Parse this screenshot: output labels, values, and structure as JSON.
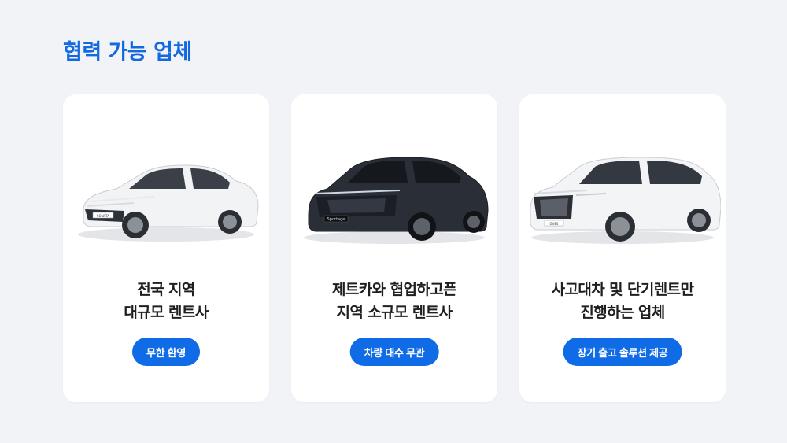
{
  "section": {
    "title": "협력 가능 업체"
  },
  "cards": [
    {
      "title_line1": "전국 지역",
      "title_line2": "대규모 렌트사",
      "badge": "무한 환영",
      "car": {
        "icon": "white-sedan-image",
        "plate_text": "SONATA",
        "body_color": "#f2f3f5"
      }
    },
    {
      "title_line1": "제트카와 협업하고픈",
      "title_line2": "지역 소규모 렌트사",
      "badge": "차량 대수 무관",
      "car": {
        "icon": "dark-suv-image",
        "plate_text": "Sportage",
        "body_color": "#2a2e37"
      }
    },
    {
      "title_line1": "사고대차 및 단기렌트만",
      "title_line2": "진행하는 업체",
      "badge": "장기 출고 솔루션 제공",
      "car": {
        "icon": "white-large-suv-image",
        "plate_text": "GV80",
        "body_color": "#f3f4f6"
      }
    }
  ],
  "colors": {
    "accent": "#1269e0",
    "badge": "#0f6be6",
    "background": "#f1f3f6",
    "card": "#ffffff"
  }
}
